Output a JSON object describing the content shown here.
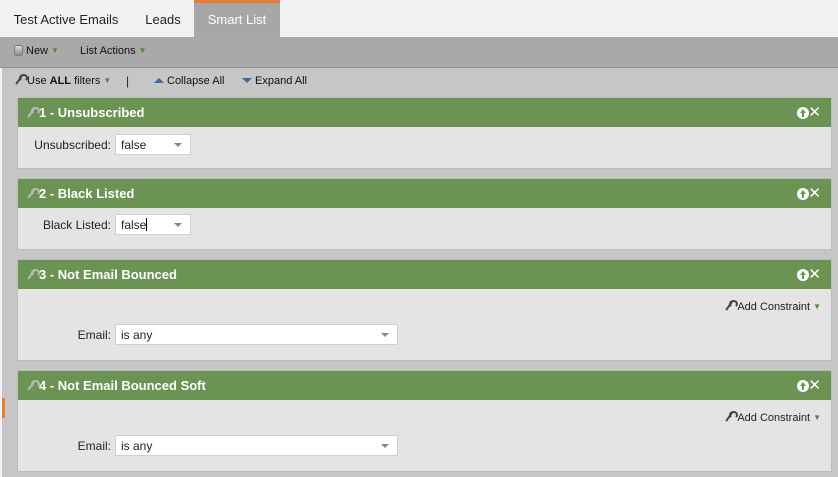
{
  "tabs": [
    {
      "label": "Test Active Emails"
    },
    {
      "label": "Leads"
    },
    {
      "label": "Smart List"
    }
  ],
  "toolbar": {
    "new_label": "New",
    "list_actions_label": "List Actions"
  },
  "filterbar": {
    "use_all_prefix": "Use ",
    "use_all_bold": "ALL",
    "use_all_suffix": " filters",
    "separator": "|",
    "collapse_all": "Collapse All",
    "expand_all": "Expand All"
  },
  "filters": [
    {
      "title": "1 - Unsubscribed",
      "field_label": "Unsubscribed:",
      "value": "false"
    },
    {
      "title": "2 - Black Listed",
      "field_label": "Black Listed:",
      "value": "false"
    },
    {
      "title": "3 - Not Email Bounced",
      "field_label": "Email:",
      "value": "is any",
      "add_constraint": "Add Constraint"
    },
    {
      "title": "4 - Not Email Bounced Soft",
      "field_label": "Email:",
      "value": "is any",
      "add_constraint": "Add Constraint"
    }
  ],
  "colors": {
    "header_green": "#6a9354",
    "active_tab_accent": "#e57d38",
    "toolbar_gray": "#a9a9a9"
  }
}
